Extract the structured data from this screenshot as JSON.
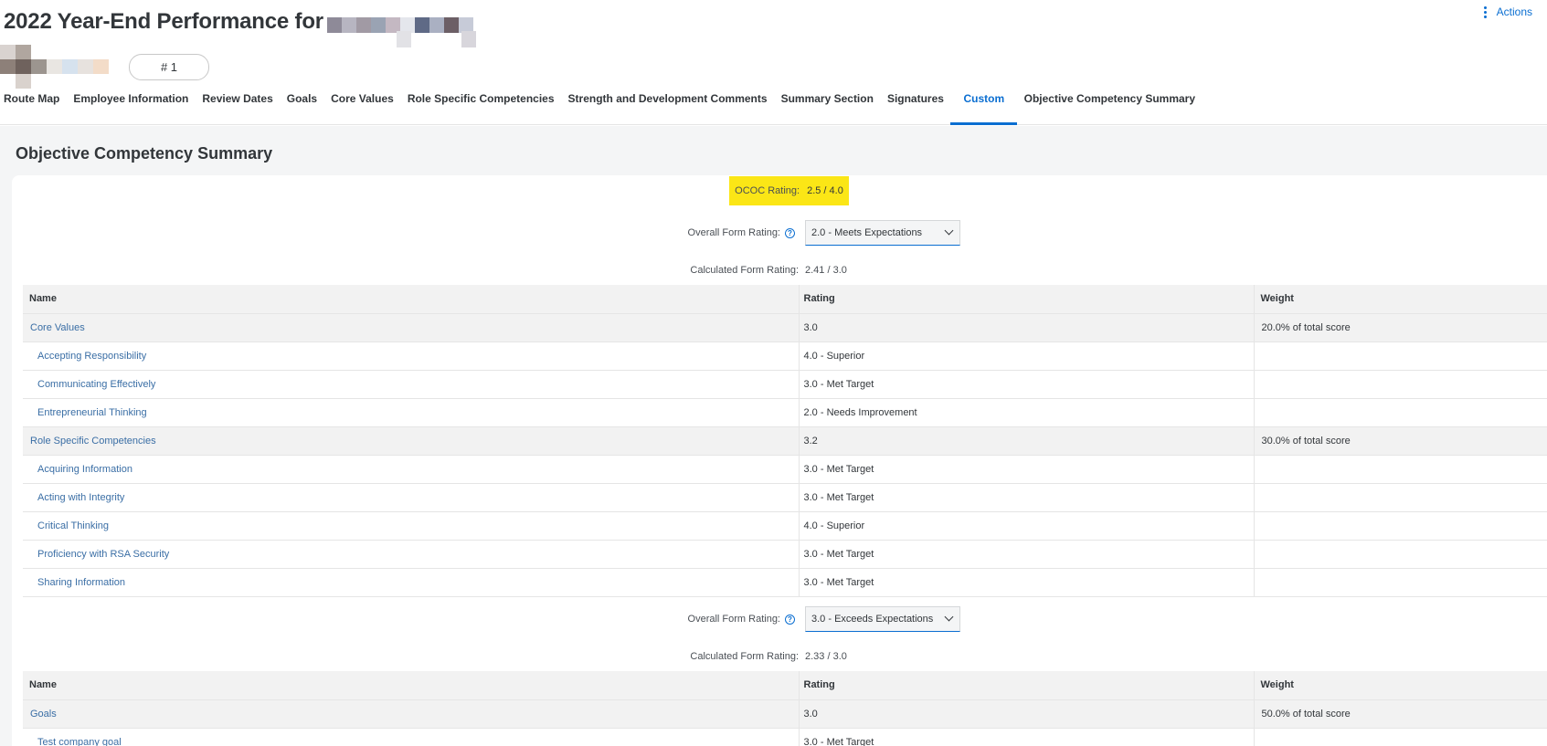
{
  "header": {
    "title": "2022 Year-End Performance for",
    "badge": "# 1",
    "actions_label": "Actions"
  },
  "tabs": [
    {
      "label": "Route Map"
    },
    {
      "label": "Employee Information"
    },
    {
      "label": "Review Dates"
    },
    {
      "label": "Goals"
    },
    {
      "label": "Core Values"
    },
    {
      "label": "Role Specific Competencies"
    },
    {
      "label": "Strength and Development Comments"
    },
    {
      "label": "Summary Section"
    },
    {
      "label": "Signatures"
    },
    {
      "label": "Custom",
      "active": true
    },
    {
      "label": "Objective Competency Summary"
    }
  ],
  "summary": {
    "section_title": "Objective Competency Summary",
    "ococ_label": "OCOC Rating:",
    "ococ_value": "2.5 / 4.0",
    "block1": {
      "overall_label": "Overall Form Rating:",
      "overall_value": "2.0 - Meets Expectations",
      "calc_label": "Calculated Form Rating:",
      "calc_value": "2.41 / 3.0"
    },
    "block2": {
      "overall_label": "Overall Form Rating:",
      "overall_value": "3.0 - Exceeds Expectations",
      "calc_label": "Calculated Form Rating:",
      "calc_value": "2.33 / 3.0"
    },
    "columns": {
      "name": "Name",
      "rating": "Rating",
      "weight": "Weight"
    },
    "table1": [
      {
        "name": "Core Values",
        "rating": "3.0",
        "weight": "20.0% of total score",
        "group": true
      },
      {
        "name": "Accepting Responsibility",
        "rating": "4.0 - Superior",
        "weight": ""
      },
      {
        "name": "Communicating Effectively",
        "rating": "3.0 - Met Target",
        "weight": ""
      },
      {
        "name": "Entrepreneurial Thinking",
        "rating": "2.0 - Needs Improvement",
        "weight": ""
      },
      {
        "name": "Role Specific Competencies",
        "rating": "3.2",
        "weight": "30.0% of total score",
        "group": true
      },
      {
        "name": "Acquiring Information",
        "rating": "3.0 - Met Target",
        "weight": ""
      },
      {
        "name": "Acting with Integrity",
        "rating": "3.0 - Met Target",
        "weight": ""
      },
      {
        "name": "Critical Thinking",
        "rating": "4.0 - Superior",
        "weight": ""
      },
      {
        "name": "Proficiency with RSA Security",
        "rating": "3.0 - Met Target",
        "weight": ""
      },
      {
        "name": "Sharing Information",
        "rating": "3.0 - Met Target",
        "weight": ""
      }
    ],
    "table2": [
      {
        "name": "Goals",
        "rating": "3.0",
        "weight": "50.0% of total score",
        "group": true
      },
      {
        "name": "Test company goal",
        "rating": "3.0 - Met Target",
        "weight": ""
      }
    ]
  },
  "colors": {
    "accent": "#0a6ed1",
    "highlight": "#fbe616",
    "link": "#3a6ea5"
  }
}
